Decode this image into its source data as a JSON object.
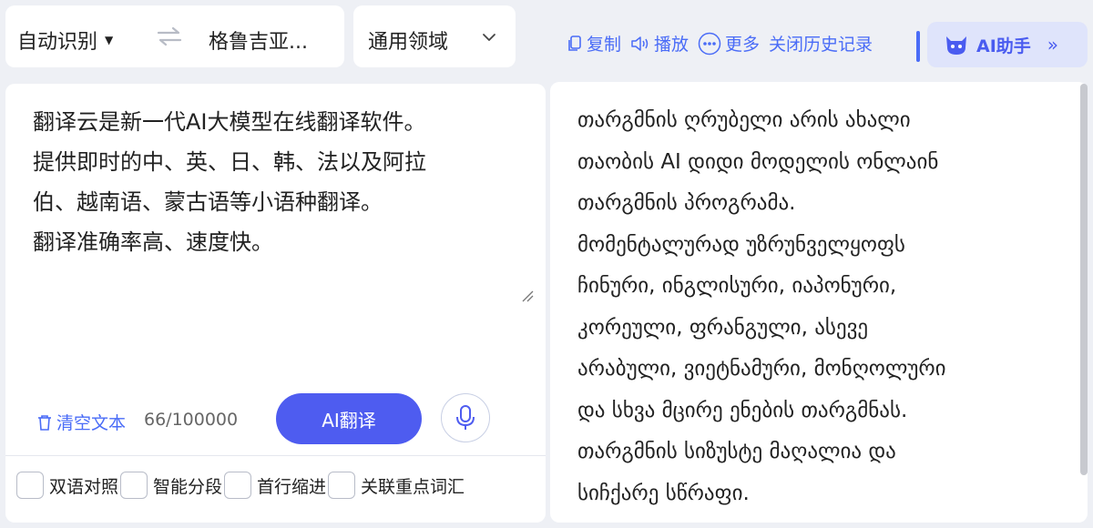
{
  "toolbar": {
    "source_language": "自动识别",
    "target_language": "格鲁吉亚...",
    "domain": "通用领域",
    "copy_label": "复制",
    "play_label": "播放",
    "more_label": "更多",
    "close_history_label": "关闭历史记录",
    "ai_assistant_label": "AI助手"
  },
  "source": {
    "lines": [
      "翻译云是新一代AI大模型在线翻译软件。",
      "提供即时的中、英、日、韩、法以及阿拉",
      "伯、越南语、蒙古语等小语种翻译。",
      "翻译准确率高、速度快。"
    ],
    "clear_label": "清空文本",
    "char_count": "66/100000",
    "translate_label": "AI翻译"
  },
  "options": [
    {
      "label": "双语对照",
      "checked": false
    },
    {
      "label": "智能分段",
      "checked": false
    },
    {
      "label": "首行缩进",
      "checked": false
    },
    {
      "label": "关联重点词汇",
      "checked": false
    }
  ],
  "result": {
    "lines": [
      "თარგმნის ღრუბელი არის ახალი",
      "თაობის AI დიდი მოდელის ონლაინ",
      "თარგმნის პროგრამა.",
      "მომენტალურად უზრუნველყოფს",
      "ჩინური, ინგლისური, იაპონური,",
      "კორეული, ფრანგული, ასევე",
      "არაბული, ვიეტნამური, მონღოლური",
      "და სხვა მცირე ენების თარგმნას.",
      "თარგმნის სიზუსტე მაღალია და",
      "სიჩქარე სწრაფი."
    ]
  },
  "colors": {
    "accent": "#4a6cf7",
    "primary_button": "#4e5cf0",
    "background": "#eef0f5"
  }
}
